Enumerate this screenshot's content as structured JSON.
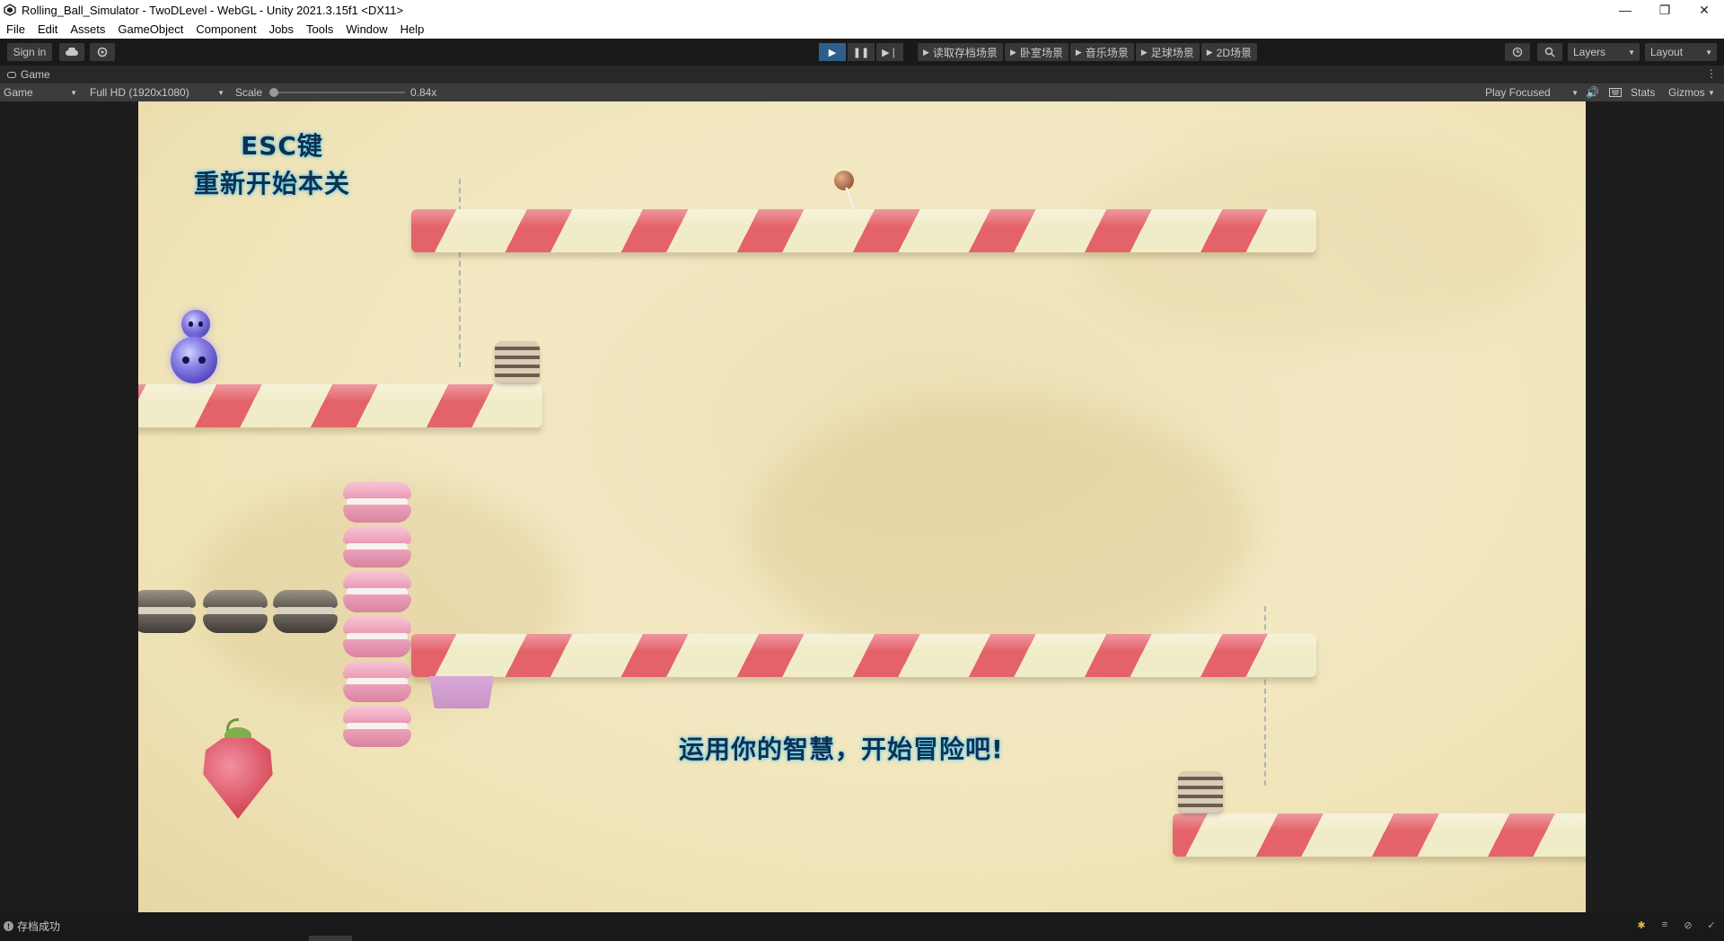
{
  "window": {
    "title": "Rolling_Ball_Simulator - TwoDLevel - WebGL - Unity 2021.3.15f1 <DX11>",
    "minimize": "—",
    "maximize": "❐",
    "close": "✕"
  },
  "menu": [
    "File",
    "Edit",
    "Assets",
    "GameObject",
    "Component",
    "Jobs",
    "Tools",
    "Window",
    "Help"
  ],
  "toolbar": {
    "sign_in": "Sign in",
    "scene_buttons": [
      "读取存档场景",
      "卧室场景",
      "音乐场景",
      "足球场景",
      "2D场景"
    ],
    "layers": "Layers",
    "layout": "Layout"
  },
  "tab": {
    "label": "Game"
  },
  "gameview": {
    "display": "Game",
    "resolution": "Full HD (1920x1080)",
    "scale_label": "Scale",
    "scale_value": "0.84x",
    "play_mode": "Play Focused",
    "stats": "Stats",
    "gizmos": "Gizmos"
  },
  "game": {
    "hint_line1": "ESC键",
    "hint_line2": "重新开始本关",
    "message": "运用你的智慧，开始冒险吧!"
  },
  "status": {
    "message": "存档成功"
  },
  "colors": {
    "accent": "#2d5f8a",
    "cane_red": "#e4636b",
    "cane_cream": "#f1ecc8",
    "text_glow": "#3fb9e6"
  }
}
